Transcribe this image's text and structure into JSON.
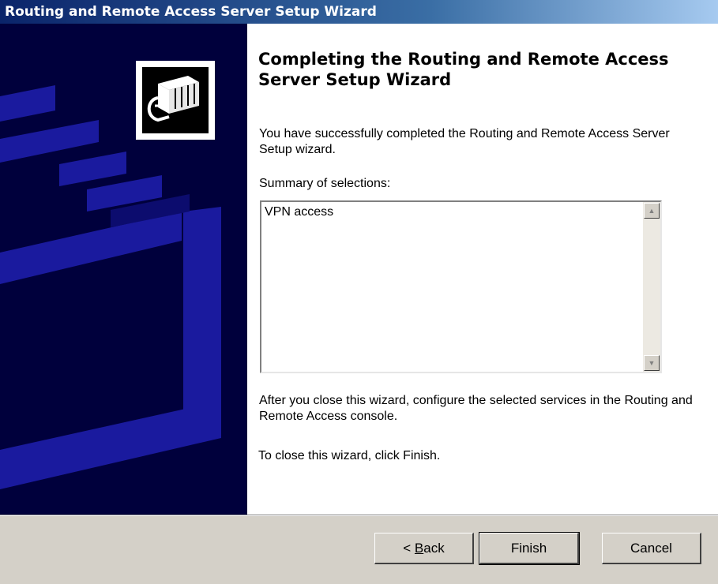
{
  "window": {
    "title": "Routing and Remote Access Server Setup Wizard"
  },
  "wizard": {
    "heading": "Completing the Routing and Remote Access Server Setup Wizard",
    "success_text": "You have successfully completed the Routing and Remote Access Server Setup wizard.",
    "summary_label": "Summary of selections:",
    "summary_items": [
      "VPN access"
    ],
    "after_close_text": "After you close this wizard, configure the selected services in the Routing and  Remote Access console.",
    "close_instruction": "To close this wizard, click Finish."
  },
  "buttons": {
    "back_prefix": "< ",
    "back_mnemonic": "B",
    "back_rest": "ack",
    "finish": "Finish",
    "cancel": "Cancel"
  },
  "icons": {
    "banner": "network-plug-icon",
    "scroll_up": "scroll-up-arrow-icon",
    "scroll_down": "scroll-down-arrow-icon"
  },
  "colors": {
    "title_bar": "#0a246a",
    "banner_background": "#00003c",
    "banner_shapes": "#1b1ba0",
    "dialog_face": "#d4d0c8"
  }
}
